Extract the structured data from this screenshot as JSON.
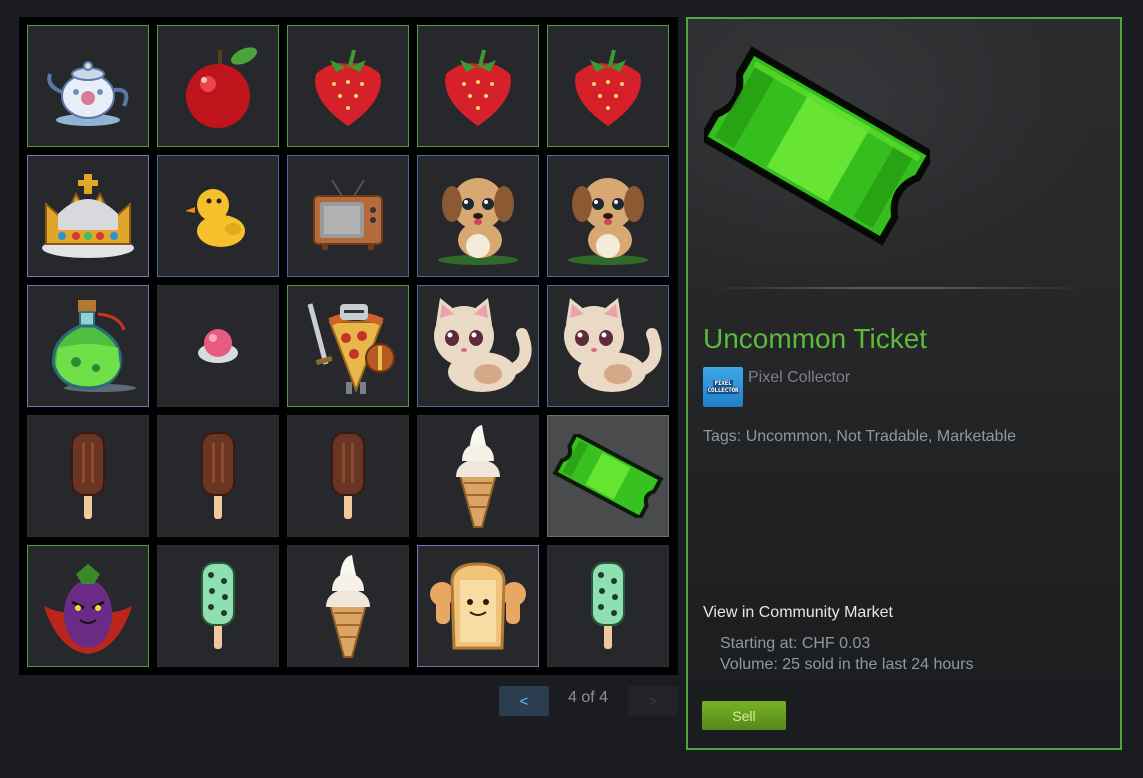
{
  "inventory": {
    "slots": [
      {
        "icon": "teapot-icon",
        "quality": "green"
      },
      {
        "icon": "apple-icon",
        "quality": "green"
      },
      {
        "icon": "strawberry-icon",
        "quality": "green"
      },
      {
        "icon": "strawberry-icon",
        "quality": "green"
      },
      {
        "icon": "strawberry-icon",
        "quality": "green"
      },
      {
        "icon": "crown-icon",
        "quality": "purple"
      },
      {
        "icon": "duck-icon",
        "quality": "blue"
      },
      {
        "icon": "tv-icon",
        "quality": "blue"
      },
      {
        "icon": "puppy-icon",
        "quality": "blue"
      },
      {
        "icon": "puppy-icon",
        "quality": "blue"
      },
      {
        "icon": "potion-icon",
        "quality": "purple"
      },
      {
        "icon": "ice-cream-scoop-icon",
        "quality": "none"
      },
      {
        "icon": "pizza-knight-icon",
        "quality": "green"
      },
      {
        "icon": "kitten-icon",
        "quality": "blue"
      },
      {
        "icon": "kitten-icon",
        "quality": "blue"
      },
      {
        "icon": "popsicle-chocolate-icon",
        "quality": "none"
      },
      {
        "icon": "popsicle-chocolate-icon",
        "quality": "none"
      },
      {
        "icon": "popsicle-chocolate-icon",
        "quality": "none"
      },
      {
        "icon": "soft-serve-cone-icon",
        "quality": "none"
      },
      {
        "icon": "ticket-icon",
        "quality": "selected"
      },
      {
        "icon": "eggplant-vampire-icon",
        "quality": "green"
      },
      {
        "icon": "popsicle-mint-icon",
        "quality": "none"
      },
      {
        "icon": "soft-serve-cone-icon",
        "quality": "none"
      },
      {
        "icon": "buff-toast-icon",
        "quality": "purple"
      },
      {
        "icon": "popsicle-mint-icon",
        "quality": "none"
      }
    ]
  },
  "pager": {
    "prev_label": "<",
    "next_label": ">",
    "page_text": "4 of 4"
  },
  "detail": {
    "item_name": "Uncommon Ticket",
    "name_color": "#5bbb3a",
    "game_name": "Pixel Collector",
    "game_icon_line1": "PIXEL",
    "game_icon_line2": "COLLECTOR",
    "tags_text": "Tags: Uncommon, Not Tradable, Marketable",
    "market_title": "View in Community Market",
    "market_price": "Starting at: CHF 0.03",
    "market_volume": "Volume: 25 sold in the last 24 hours",
    "sell_label": "Sell",
    "border_color": "#4fa73c"
  }
}
